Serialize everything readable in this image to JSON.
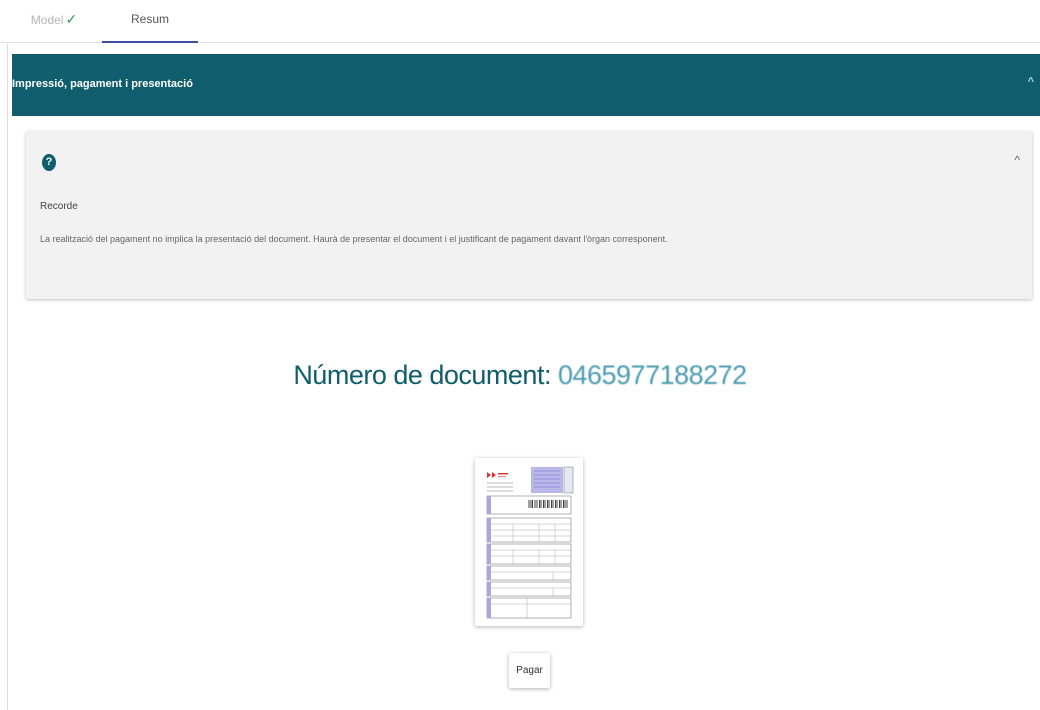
{
  "tabs": [
    {
      "label": "Model",
      "completed": true
    },
    {
      "label": "Resum",
      "active": true
    }
  ],
  "section": {
    "title": "Impressió, pagament i presentació",
    "collapse_icon": "chevron-up-icon"
  },
  "info_panel": {
    "icon": "help-icon",
    "icon_glyph": "?",
    "collapse_icon": "chevron-up-icon",
    "heading": "Recorde",
    "text": "La realització del pagament no implica la presentació del document. Haurà de presentar el document i el justificant de pagament davant l'òrgan corresponent."
  },
  "document": {
    "label": "Número de document:",
    "number": "0465977188272"
  },
  "actions": {
    "pay_label": "Pagar"
  },
  "colors": {
    "header": "#0f5d6d",
    "tab_ink": "#3b4ea3",
    "check": "#2e9d5a",
    "doc_number": "#4a9ab0"
  }
}
